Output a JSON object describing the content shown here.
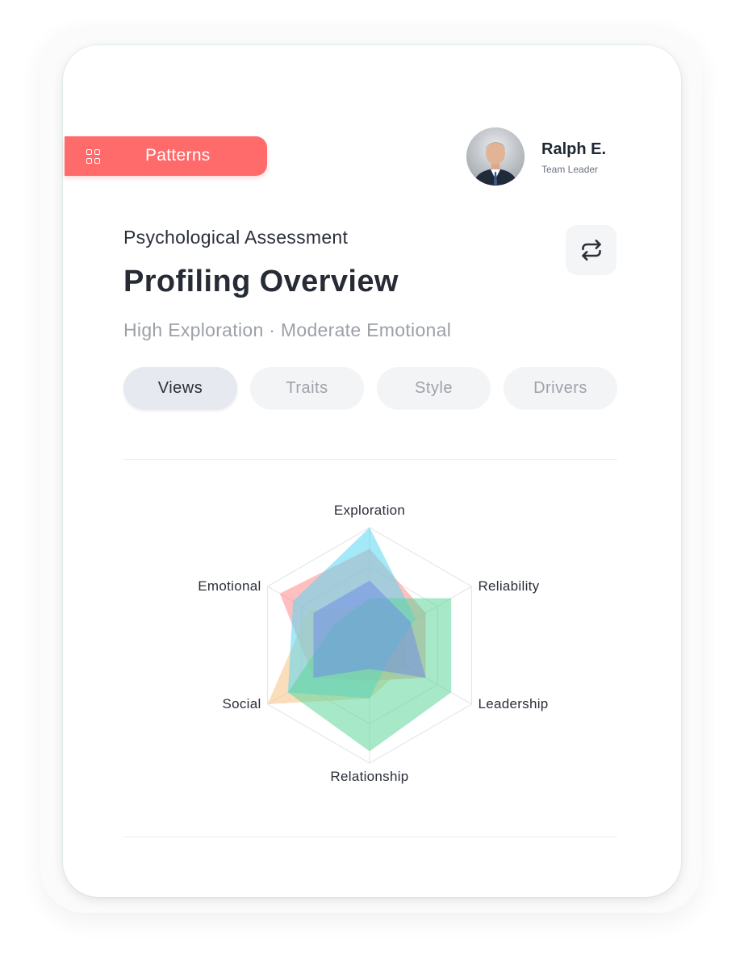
{
  "sidebar": {
    "active_label": "Patterns",
    "active_icon": "grid-icon"
  },
  "user": {
    "name": "Ralph E.",
    "role": "Team Leader"
  },
  "header": {
    "subtitle": "Psychological Assessment",
    "title": "Profiling Overview",
    "summary": "High Exploration · Moderate Emotional",
    "action_icon": "swap-icon"
  },
  "tabs": [
    {
      "label": "Views",
      "active": true
    },
    {
      "label": "Traits",
      "active": false
    },
    {
      "label": "Style",
      "active": false
    },
    {
      "label": "Drivers",
      "active": false
    }
  ],
  "colors": {
    "accent": "#ff6b6b"
  },
  "chart_data": {
    "type": "radar",
    "axes": [
      "Exploration",
      "Reliability",
      "Leadership",
      "Relationship",
      "Social",
      "Emotional"
    ],
    "range": [
      0,
      1
    ],
    "grid": true,
    "series": [
      {
        "color": "#ff8a8a",
        "values": [
          0.82,
          0.55,
          0.55,
          0.3,
          0.55,
          0.88
        ]
      },
      {
        "color": "#f6c283",
        "values": [
          0.35,
          0.35,
          0.35,
          0.45,
          1.0,
          0.6
        ]
      },
      {
        "color": "#5ad7f3",
        "values": [
          1.0,
          0.45,
          0.2,
          0.45,
          0.8,
          0.75
        ]
      },
      {
        "color": "#5cd69a",
        "values": [
          0.4,
          0.8,
          0.8,
          0.9,
          0.8,
          0.35
        ]
      },
      {
        "color": "#6f8fe6",
        "values": [
          0.55,
          0.4,
          0.55,
          0.2,
          0.55,
          0.55
        ]
      }
    ]
  }
}
